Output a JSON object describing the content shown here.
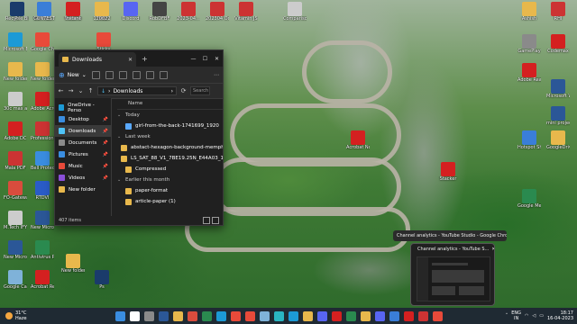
{
  "desktop": {
    "icons": [
      {
        "label": "Recycle Bin",
        "color": "#7fb2d9"
      },
      {
        "label": "Get Wo...",
        "color": "#d94c3d"
      },
      {
        "label": "Volume",
        "color": "#3a7ed8"
      },
      {
        "label": "Yildiz",
        "color": "#e8b84c"
      },
      {
        "label": "Discord",
        "color": "#5865f2"
      },
      {
        "label": "RobDFBF",
        "color": "#444"
      },
      {
        "label": "2023-04...",
        "color": "#c33"
      },
      {
        "label": "202304 Oct",
        "color": "#c33"
      },
      {
        "label": "Vitamin JS",
        "color": "#c33"
      },
      {
        "label": "Compariso...",
        "color": "#ccc"
      },
      {
        "label": "Ashish",
        "color": "#e8b84c"
      },
      {
        "label": "RHI",
        "color": "#c33"
      },
      {
        "label": "Microsoft Edge",
        "color": "#1c9ad6"
      },
      {
        "label": "Google Chrome",
        "color": "#e84a3a"
      },
      {
        "label": "New folder",
        "color": "#e8b84c"
      },
      {
        "label": "New folder",
        "color": "#e8b84c"
      },
      {
        "label": "30c max assignments",
        "color": "#ccc"
      },
      {
        "label": "Adobe Acrobat",
        "color": "#d42020"
      },
      {
        "label": "Adobe DC",
        "color": "#d42020"
      },
      {
        "label": "Professional Email",
        "color": "#c33"
      },
      {
        "label": "Mala PDF",
        "color": "#c33"
      },
      {
        "label": "Bell Protection Total Secure",
        "color": "#3a8de0"
      },
      {
        "label": "FO-Gateway",
        "color": "#d94c3d"
      },
      {
        "label": "RTDVI",
        "color": "#2a5cc7"
      },
      {
        "label": "M.Tech IFY",
        "color": "#ccc"
      },
      {
        "label": "New Microsoft W...",
        "color": "#2b5797"
      },
      {
        "label": "New Microsoft W...",
        "color": "#2b5797"
      },
      {
        "label": "Antivirus Protection",
        "color": "#2a8a4f"
      },
      {
        "label": "Google Cardboard",
        "color": "#7fb2d9"
      },
      {
        "label": "Acrobat Reader",
        "color": "#d42020"
      },
      {
        "label": "GamePlay",
        "color": "#8a8a8a"
      },
      {
        "label": "Codemax",
        "color": "#d42020"
      },
      {
        "label": "Adobe Reader",
        "color": "#d42020"
      },
      {
        "label": "Microsoft Word",
        "color": "#2b5797"
      },
      {
        "label": "mini project Final Report",
        "color": "#2b5797"
      },
      {
        "label": "Hotspot Shield",
        "color": "#3a7ed8"
      },
      {
        "label": "GoogleDrive",
        "color": "#e8b84c"
      },
      {
        "label": "Google Meet",
        "color": "#2a8a4f"
      },
      {
        "label": "Sticky",
        "color": "#e84a3a"
      },
      {
        "label": "Acrobat Notes",
        "color": "#d42020"
      },
      {
        "label": "Stacker",
        "color": "#d42020"
      },
      {
        "label": "New folder",
        "color": "#e8b84c"
      },
      {
        "label": "Ps",
        "color": "#1a3b6b"
      },
      {
        "label": "Ps",
        "color": "#1a3b6b"
      },
      {
        "label": "CONTEST",
        "color": "#3a7ed8"
      },
      {
        "label": "Instant",
        "color": "#d42020"
      },
      {
        "label": "120022",
        "color": "#e8b84c"
      }
    ]
  },
  "explorer": {
    "tab_title": "Downloads",
    "new_label": "New",
    "address": "Downloads",
    "search_placeholder": "Search",
    "nav": [
      {
        "label": "OneDrive - Perso",
        "color": "#1c9ad6",
        "pin": "",
        "selected": false
      },
      {
        "label": "Desktop",
        "color": "#3a8de0",
        "pin": "📌",
        "selected": false
      },
      {
        "label": "Downloads",
        "color": "#4fc3f7",
        "pin": "📌",
        "selected": true
      },
      {
        "label": "Documents",
        "color": "#8a8a8a",
        "pin": "📌",
        "selected": false
      },
      {
        "label": "Pictures",
        "color": "#3a8de0",
        "pin": "📌",
        "selected": false
      },
      {
        "label": "Music",
        "color": "#e84a3a",
        "pin": "📌",
        "selected": false
      },
      {
        "label": "Videos",
        "color": "#8a4fd9",
        "pin": "📌",
        "selected": false
      },
      {
        "label": "New folder",
        "color": "#e8b84c",
        "pin": "",
        "selected": false
      }
    ],
    "column_name": "Name",
    "rows": [
      {
        "type": "group",
        "label": "Today"
      },
      {
        "type": "file",
        "label": "girl-from-the-back-1741699_1920",
        "color": "#5aa9ff"
      },
      {
        "type": "group",
        "label": "Last week"
      },
      {
        "type": "file",
        "label": "abstact-hexagon-background-memphis-...",
        "color": "#e8b84c"
      },
      {
        "type": "file",
        "label": "LS_SAT_88_V1_7BE19.25N_E44A03_140c...",
        "color": "#e8b84c"
      },
      {
        "type": "file",
        "label": "Compressed",
        "color": "#e8b84c"
      },
      {
        "type": "group",
        "label": "Earlier this month"
      },
      {
        "type": "file",
        "label": "paper-format",
        "color": "#e8b84c"
      },
      {
        "type": "file",
        "label": "article-paper (1)",
        "color": "#e8b84c"
      }
    ],
    "status_text": "407 items"
  },
  "preview": {
    "title": "Channel analytics - YouTube Studio - Google Chrome",
    "thumb_title": "Channel analytics - YouTube S..."
  },
  "taskbar": {
    "weather_temp": "31°C",
    "weather_desc": "Haze",
    "icons": [
      "#3a8de0",
      "#ffffff",
      "#8a8a8a",
      "#2b5797",
      "#e8b84c",
      "#d94c3d",
      "#2a8a4f",
      "#1c9ad6",
      "#e84a3a",
      "#e84a3a",
      "#7fb2d9",
      "#2ab5c2",
      "#1c9ad6",
      "#e8b84c",
      "#5865f2",
      "#d42020",
      "#2a8a4f",
      "#e8b84c",
      "#5865f2",
      "#3a7ed8",
      "#d42020",
      "#c33",
      "#e84a3a"
    ],
    "lang_top": "ENG",
    "lang_bottom": "IN",
    "time": "18:17",
    "date": "16-04-2023"
  }
}
